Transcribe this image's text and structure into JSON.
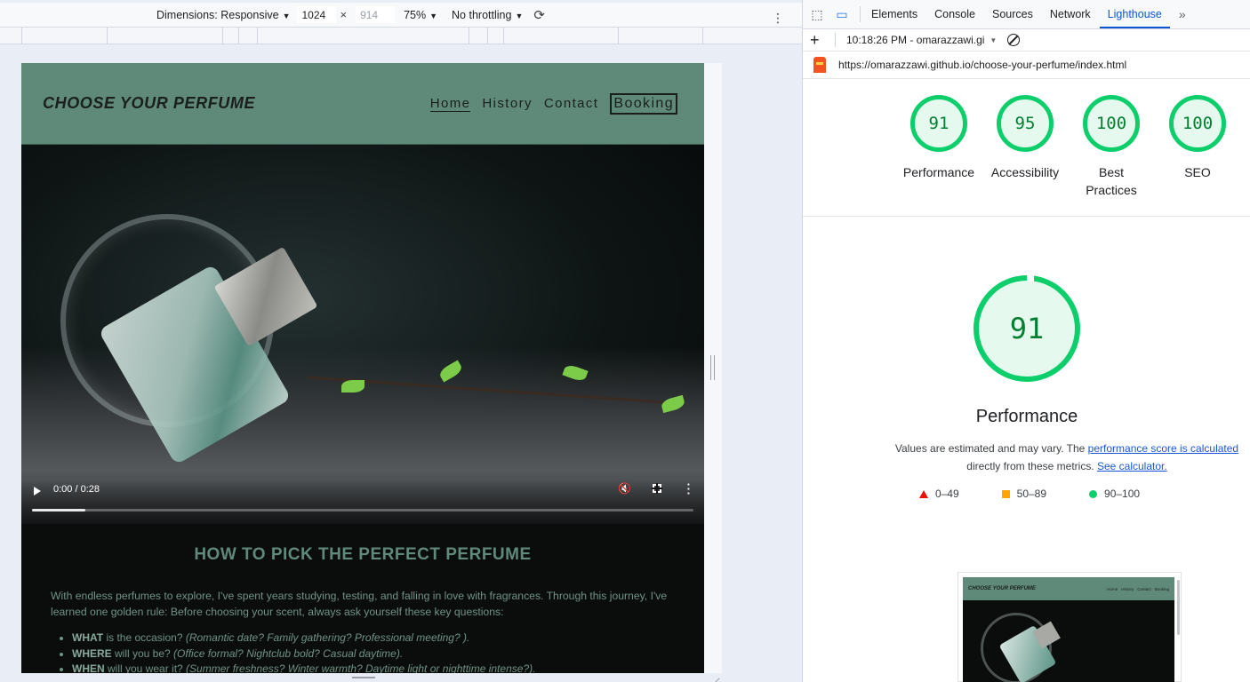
{
  "device_toolbar": {
    "dimensions_label": "Dimensions: Responsive",
    "width": "1024",
    "height": "914",
    "times": "×",
    "zoom": "75%",
    "throttling": "No throttling",
    "caret": "▼",
    "more": "⋮"
  },
  "site": {
    "logo": "CHOOSE YOUR PERFUME",
    "nav": [
      "Home",
      "History",
      "Contact",
      "Booking"
    ],
    "video": {
      "time": "0:00 / 0:28",
      "progress": 0.08
    },
    "heading": "HOW TO PICK THE PERFECT PERFUME",
    "intro": "With endless perfumes to explore, I've spent years studying, testing, and falling in love with fragrances. Through this journey, I've learned one golden rule: Before choosing your scent, always ask yourself these key questions:",
    "questions": [
      {
        "key": "WHAT",
        "text": " is the occasion? ",
        "hint": "(Romantic date? Family gathering? Professional meeting? )."
      },
      {
        "key": "WHERE",
        "text": " will you be? ",
        "hint": "(Office formal? Nightclub bold? Casual daytime)."
      },
      {
        "key": "WHEN",
        "text": " will you wear it? ",
        "hint": "(Summer freshness? Winter warmth? Daytime light or nighttime intense?)."
      }
    ]
  },
  "devtools": {
    "tabs": [
      "Elements",
      "Console",
      "Sources",
      "Network",
      "Lighthouse"
    ],
    "active_tab": "Lighthouse",
    "more_tabs": "»",
    "report_label": "10:18:26 PM - omarazzawi.gi",
    "url": "https://omarazzawi.github.io/choose-your-perfume/index.html",
    "scores": [
      {
        "label": "Performance",
        "value": "91"
      },
      {
        "label": "Accessibility",
        "value": "95"
      },
      {
        "label": "Best Practices",
        "value": "100"
      },
      {
        "label": "SEO",
        "value": "100"
      }
    ],
    "perf": {
      "value": "91",
      "title": "Performance",
      "note_prefix": "Values are estimated and may vary. The ",
      "note_link1": "performance score is calculated",
      "note_mid": " directly from these metrics. ",
      "note_link2": "See calculator."
    },
    "legend": [
      "0–49",
      "50–89",
      "90–100"
    ],
    "thumbnail": {
      "logo": "CHOOSE YOUR PERFUME",
      "nav": [
        "Home",
        "History",
        "Contact",
        "Booking"
      ]
    },
    "colors": {
      "pass": "#0cce6b",
      "average": "#ffa400",
      "fail": "#eb0f00",
      "accent": "#0b57d0"
    }
  }
}
